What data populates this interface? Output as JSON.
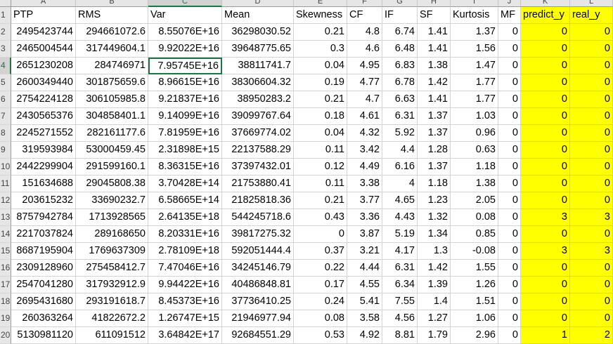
{
  "column_letters": [
    "A",
    "B",
    "C",
    "D",
    "E",
    "F",
    "G",
    "H",
    "I",
    "J",
    "K",
    "L"
  ],
  "selected_column": 2,
  "row_numbers": [
    "1",
    "2",
    "3",
    "4",
    "5",
    "6",
    "7",
    "8",
    "9",
    "10",
    "11",
    "12",
    "13",
    "14",
    "15",
    "16",
    "17",
    "18",
    "19",
    "20"
  ],
  "selected_row": 3,
  "active_cell": {
    "row": 3,
    "col": 2
  },
  "highlight_color": "#ffff00",
  "highlight_columns": [
    10,
    11
  ],
  "headers": [
    "PTP",
    "RMS",
    "Var",
    "Mean",
    "Skewness",
    "CF",
    "IF",
    "SF",
    "Kurtosis",
    "MF",
    "predict_y",
    "real_y"
  ],
  "rows": [
    [
      "2495423744",
      "294661072.6",
      "8.55076E+16",
      "36298030.52",
      "0.21",
      "4.8",
      "6.74",
      "1.41",
      "1.37",
      "0",
      "0",
      "0"
    ],
    [
      "2465004544",
      "317449604.1",
      "9.92022E+16",
      "39648775.65",
      "0.3",
      "4.6",
      "6.48",
      "1.41",
      "1.56",
      "0",
      "0",
      "0"
    ],
    [
      "2651230208",
      "284746971",
      "7.95745E+16",
      "38811741.7",
      "0.04",
      "4.95",
      "6.83",
      "1.38",
      "1.47",
      "0",
      "0",
      "0"
    ],
    [
      "2600349440",
      "301875659.6",
      "8.96615E+16",
      "38306604.32",
      "0.19",
      "4.77",
      "6.78",
      "1.42",
      "1.77",
      "0",
      "0",
      "0"
    ],
    [
      "2754224128",
      "306105985.8",
      "9.21837E+16",
      "38950283.2",
      "0.21",
      "4.7",
      "6.63",
      "1.41",
      "1.77",
      "0",
      "0",
      "0"
    ],
    [
      "2430565376",
      "304858401.1",
      "9.14099E+16",
      "39099767.64",
      "0.18",
      "4.61",
      "6.31",
      "1.37",
      "1.03",
      "0",
      "0",
      "0"
    ],
    [
      "2245271552",
      "282161177.6",
      "7.81959E+16",
      "37669774.02",
      "0.04",
      "4.32",
      "5.92",
      "1.37",
      "0.96",
      "0",
      "0",
      "0"
    ],
    [
      "319593984",
      "53000459.45",
      "2.31898E+15",
      "22137588.29",
      "0.11",
      "3.42",
      "4.4",
      "1.28",
      "0.63",
      "0",
      "0",
      "0"
    ],
    [
      "2442299904",
      "291599160.1",
      "8.36315E+16",
      "37397432.01",
      "0.12",
      "4.49",
      "6.16",
      "1.37",
      "1.18",
      "0",
      "0",
      "0"
    ],
    [
      "151634688",
      "29045808.38",
      "3.70428E+14",
      "21753880.41",
      "0.11",
      "3.38",
      "4",
      "1.18",
      "1.38",
      "0",
      "0",
      "0"
    ],
    [
      "203615232",
      "33690232.7",
      "6.58665E+14",
      "21825818.36",
      "0.21",
      "3.77",
      "4.65",
      "1.23",
      "2.05",
      "0",
      "0",
      "0"
    ],
    [
      "8757942784",
      "1713928565",
      "2.64135E+18",
      "544245718.6",
      "0.43",
      "3.36",
      "4.43",
      "1.32",
      "0.08",
      "0",
      "3",
      "3"
    ],
    [
      "2217037824",
      "289168650",
      "8.20331E+16",
      "39817275.32",
      "0",
      "3.87",
      "5.19",
      "1.34",
      "0.85",
      "0",
      "0",
      "0"
    ],
    [
      "8687195904",
      "1769637309",
      "2.78109E+18",
      "592051444.4",
      "0.37",
      "3.21",
      "4.17",
      "1.3",
      "-0.08",
      "0",
      "3",
      "3"
    ],
    [
      "2309128960",
      "275458412.7",
      "7.47046E+16",
      "34245146.79",
      "0.22",
      "4.44",
      "6.31",
      "1.42",
      "1.55",
      "0",
      "0",
      "0"
    ],
    [
      "2547041280",
      "317932912.9",
      "9.94422E+16",
      "40486848.81",
      "0.17",
      "4.55",
      "6.34",
      "1.39",
      "1.26",
      "0",
      "0",
      "0"
    ],
    [
      "2695431680",
      "293191618.7",
      "8.45373E+16",
      "37736410.25",
      "0.24",
      "5.41",
      "7.55",
      "1.4",
      "1.51",
      "0",
      "0",
      "0"
    ],
    [
      "260363264",
      "41822672.2",
      "1.26747E+15",
      "21946977.94",
      "0.08",
      "3.58",
      "4.56",
      "1.27",
      "1.06",
      "0",
      "0",
      "0"
    ],
    [
      "5130981120",
      "611091512",
      "3.64842E+17",
      "92684551.29",
      "0.53",
      "4.92",
      "8.81",
      "1.79",
      "2.96",
      "0",
      "1",
      "2"
    ]
  ]
}
